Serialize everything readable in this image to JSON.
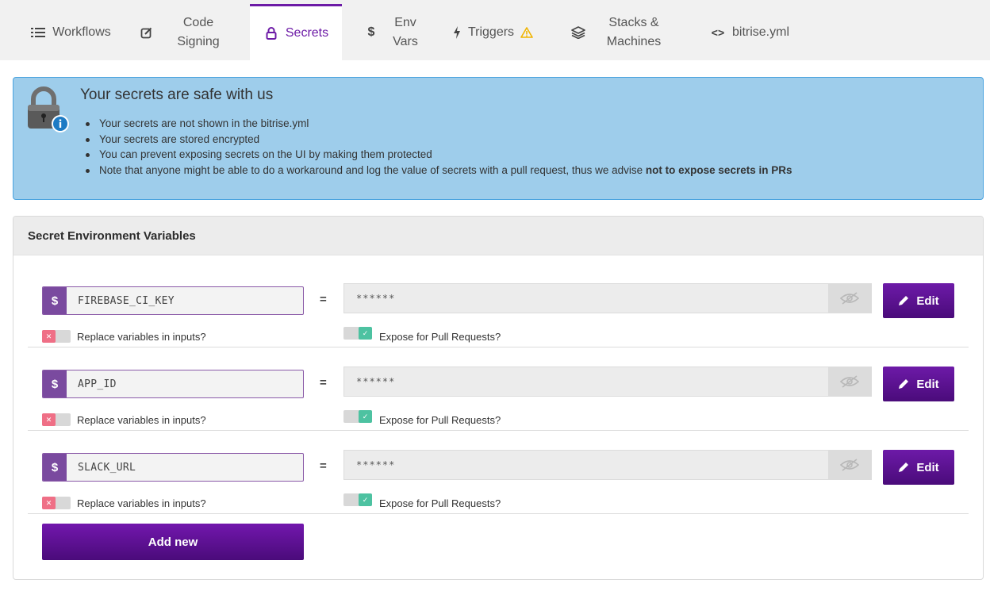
{
  "tabs": [
    {
      "label": "Workflows",
      "icon": "list-icon"
    },
    {
      "label": "Code Signing",
      "icon": "edit-square-icon"
    },
    {
      "label": "Secrets",
      "icon": "lock-icon",
      "active": true
    },
    {
      "label": "Env Vars",
      "icon": "dollar-icon"
    },
    {
      "label": "Triggers",
      "icon": "bolt-icon",
      "badge_icon": "warning-icon"
    },
    {
      "label": "Stacks & Machines",
      "icon": "layers-icon"
    },
    {
      "label": "bitrise.yml",
      "icon": "code-icon"
    }
  ],
  "info": {
    "title": "Your secrets are safe with us",
    "bullets": [
      "Your secrets are not shown in the bitrise.yml",
      "Your secrets are stored encrypted",
      "You can prevent exposing secrets on the UI by making them protected"
    ],
    "last_bullet_prefix": "Note that anyone might be able to do a workaround and log the value of secrets with a pull request, thus we advise ",
    "last_bullet_bold": "not to expose secrets in PRs"
  },
  "card": {
    "title": "Secret Environment Variables",
    "equals": "=",
    "dollar": "$",
    "edit_label": "Edit",
    "replace_label": "Replace variables in inputs?",
    "expose_label": "Expose for Pull Requests?",
    "add_label": "Add new",
    "secrets": [
      {
        "key": "FIREBASE_CI_KEY",
        "value": "******",
        "replace_vars": false,
        "expose_pr": true
      },
      {
        "key": "APP_ID",
        "value": "******",
        "replace_vars": false,
        "expose_pr": true
      },
      {
        "key": "SLACK_URL",
        "value": "******",
        "replace_vars": false,
        "expose_pr": true
      }
    ]
  },
  "colors": {
    "accent": "#6c1aa6",
    "info_bg": "#9ecdeb",
    "toggle_off": "#ef6f86",
    "toggle_on": "#4dc2a1"
  }
}
